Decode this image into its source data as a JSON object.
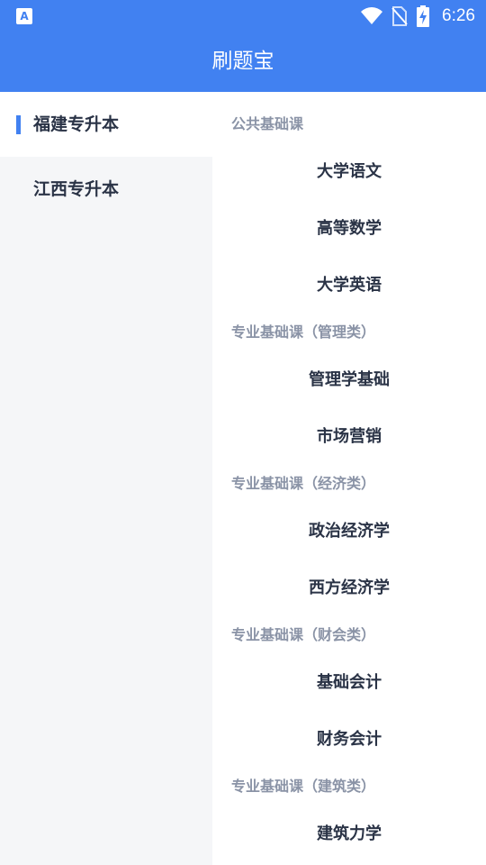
{
  "status_bar": {
    "left_icon": "A",
    "time": "6:26",
    "icons": [
      "wifi-icon",
      "no-sim-icon",
      "battery-charging-icon"
    ]
  },
  "app_bar": {
    "title": "刷题宝"
  },
  "sidebar": {
    "items": [
      {
        "label": "福建专升本",
        "active": true
      },
      {
        "label": "江西专升本",
        "active": false
      }
    ]
  },
  "content": {
    "sections": [
      {
        "header": "公共基础课",
        "courses": [
          "大学语文",
          "高等数学",
          "大学英语"
        ]
      },
      {
        "header": "专业基础课（管理类）",
        "courses": [
          "管理学基础",
          "市场营销"
        ]
      },
      {
        "header": "专业基础课（经济类）",
        "courses": [
          "政治经济学",
          "西方经济学"
        ]
      },
      {
        "header": "专业基础课（财会类）",
        "courses": [
          "基础会计",
          "财务会计"
        ]
      },
      {
        "header": "专业基础课（建筑类）",
        "courses": [
          "建筑力学"
        ]
      }
    ]
  },
  "colors": {
    "primary": "#4181f1",
    "sidebar_bg": "#f5f6f8",
    "text_dark": "#2a3346",
    "text_muted": "#8a93a6"
  }
}
